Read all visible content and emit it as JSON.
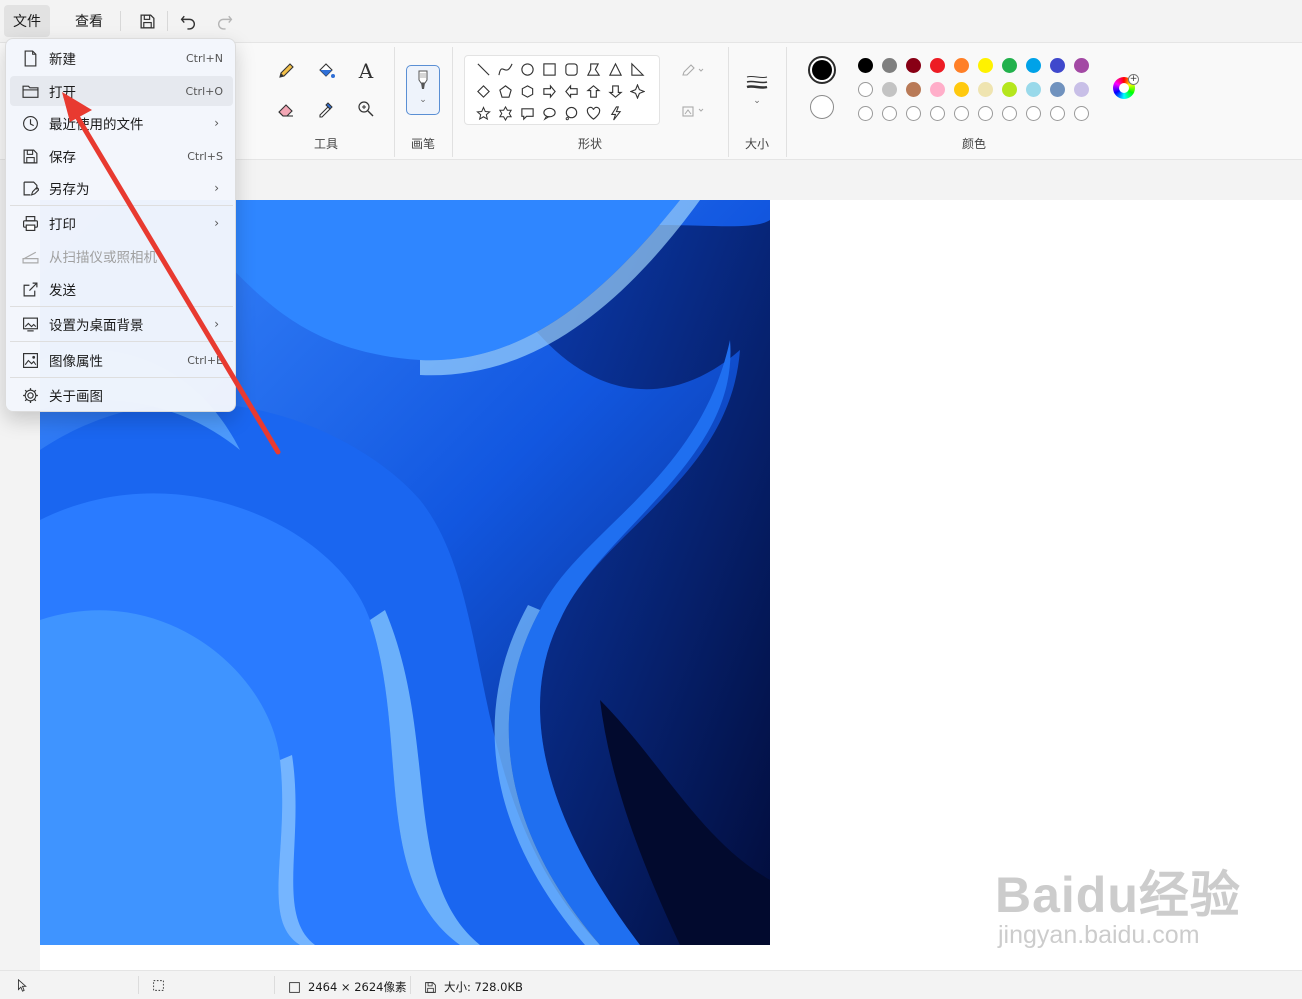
{
  "menubar": {
    "file_label": "文件",
    "view_label": "查看"
  },
  "ribbon": {
    "tools_label": "工具",
    "brushes_label": "画笔",
    "shapes_label": "形状",
    "size_label": "大小",
    "colors_label": "颜色",
    "text_tool_glyph": "A"
  },
  "palette": {
    "row1": [
      "#000000",
      "#7f7f7f",
      "#880015",
      "#ed1c24",
      "#ff7f27",
      "#fff200",
      "#22b14c",
      "#00a2e8",
      "#3f48cc",
      "#a349a4"
    ],
    "row2": [
      "#ffffff",
      "#c3c3c3",
      "#b97a57",
      "#ffaec9",
      "#ffc90e",
      "#efe4b0",
      "#b5e61d",
      "#99d9ea",
      "#7092be",
      "#c8bfe7"
    ],
    "primary_color": "#000000",
    "secondary_color": "#ffffff"
  },
  "file_menu": {
    "items": [
      {
        "label": "新建",
        "shortcut": "Ctrl+N",
        "icon": "new-file-icon"
      },
      {
        "label": "打开",
        "shortcut": "Ctrl+O",
        "icon": "folder-open-icon"
      },
      {
        "label": "最近使用的文件",
        "icon": "clock-icon"
      },
      {
        "label": "保存",
        "shortcut": "Ctrl+S",
        "icon": "save-icon"
      },
      {
        "label": "另存为",
        "icon": "save-as-icon"
      },
      {
        "label": "打印",
        "icon": "printer-icon"
      },
      {
        "label": "从扫描仪或照相机",
        "icon": "scanner-icon"
      },
      {
        "label": "发送",
        "icon": "share-icon"
      },
      {
        "label": "设置为桌面背景",
        "icon": "desktop-background-icon"
      },
      {
        "label": "图像属性",
        "shortcut": "Ctrl+E",
        "icon": "image-properties-icon"
      },
      {
        "label": "关于画图",
        "icon": "gear-icon"
      }
    ]
  },
  "status": {
    "dimensions": "2464 × 2624像素",
    "file_size": "大小: 728.0KB"
  },
  "watermark": {
    "main": "Baidu经验",
    "sub": "jingyan.baidu.com"
  }
}
